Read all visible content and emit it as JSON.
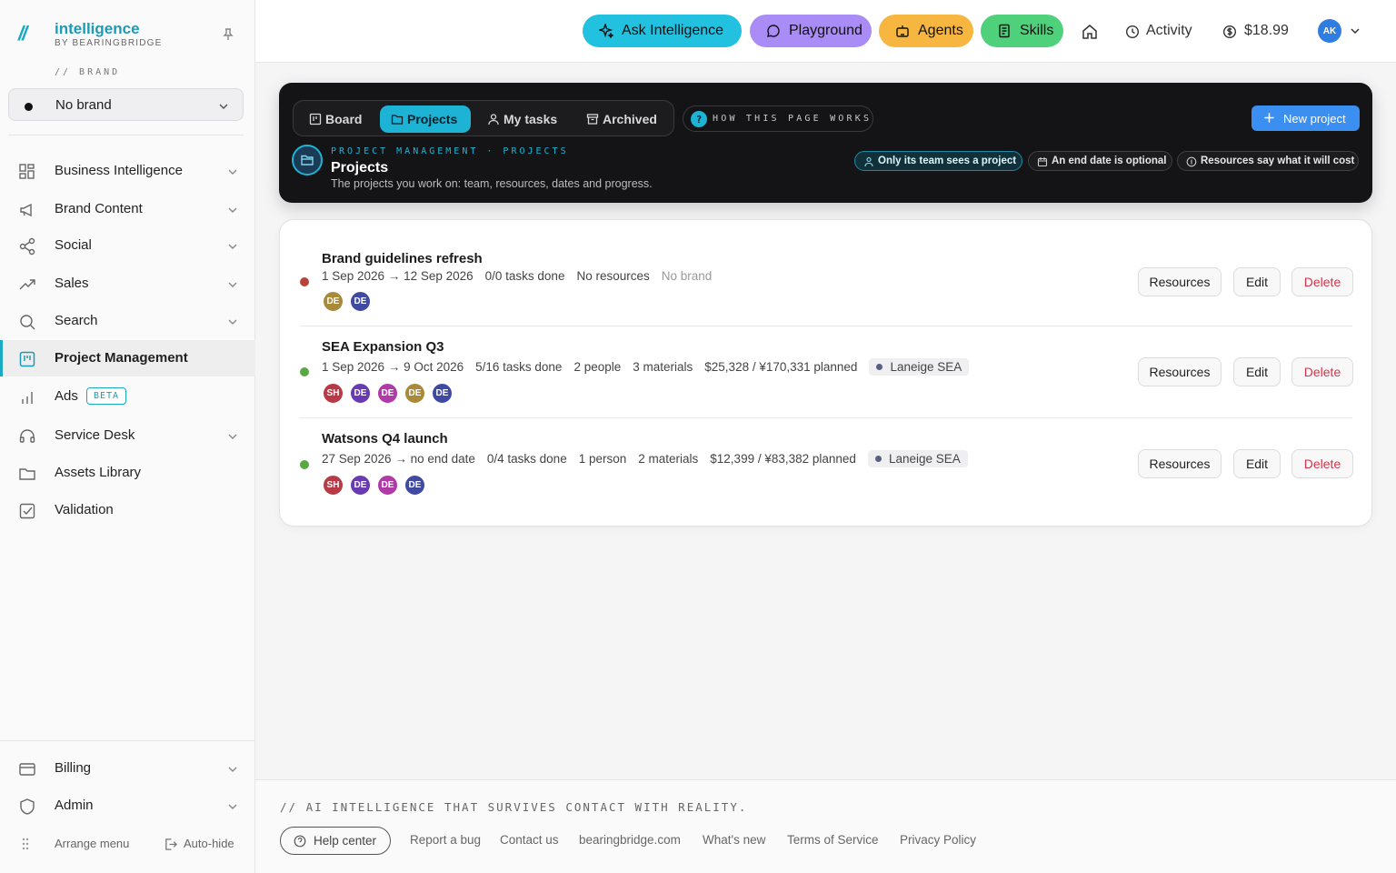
{
  "sidebar": {
    "logo_mark": "//",
    "logo_title": "intelligence",
    "logo_subtitle": "BY BEARINGBRIDGE",
    "brand_label": "// BRAND",
    "brand_select": "No brand",
    "items": [
      {
        "label": "Business Intelligence",
        "icon": "grid-icon"
      },
      {
        "label": "Brand Content",
        "icon": "megaphone-icon"
      },
      {
        "label": "Social",
        "icon": "share-icon"
      },
      {
        "label": "Sales",
        "icon": "trend-up-icon"
      },
      {
        "label": "Search",
        "icon": "search-icon"
      },
      {
        "label": "Project Management",
        "icon": "kanban-icon",
        "active": true
      },
      {
        "label": "Ads",
        "icon": "bar-chart-icon",
        "badge": "BETA"
      },
      {
        "label": "Service Desk",
        "icon": "headset-icon"
      },
      {
        "label": "Assets Library",
        "icon": "folder-icon"
      },
      {
        "label": "Validation",
        "icon": "checkbox-icon"
      }
    ],
    "bottom_items": [
      {
        "label": "Billing",
        "icon": "card-icon"
      },
      {
        "label": "Admin",
        "icon": "shield-icon"
      }
    ],
    "arrange_label": "Arrange menu",
    "autohide_label": "Auto-hide"
  },
  "topbar": {
    "ask": "Ask Intelligence",
    "playground": "Playground",
    "agents": "Agents",
    "skills": "Skills",
    "activity": "Activity",
    "balance": "$18.99",
    "avatar": "AK",
    "colors": {
      "ask": "#22c1e0",
      "playground": "#a98cf5",
      "agents": "#f6b63f",
      "skills": "#4fd07a"
    }
  },
  "hero": {
    "tabs": [
      "Board",
      "Projects",
      "My tasks",
      "Archived"
    ],
    "active_tab": "Projects",
    "how": "HOW THIS PAGE WORKS",
    "new_project": "New project",
    "eyebrow": "PROJECT MANAGEMENT · PROJECTS",
    "title": "Projects",
    "subtitle": "The projects you work on: team, resources, dates and progress.",
    "chips": [
      "Only its team sees a project",
      "An end date is optional",
      "Resources say what it will cost"
    ]
  },
  "projects": [
    {
      "name": "Brand guidelines refresh",
      "status_color": "#b8433a",
      "dates": "1 Sep 2026 → 12 Sep 2026",
      "tasks": "0/0 tasks done",
      "resources": "No resources",
      "brand": "No brand",
      "avatars": [
        {
          "initials": "DE",
          "color": "#a88a3a"
        },
        {
          "initials": "DE",
          "color": "#3f4aa0"
        }
      ]
    },
    {
      "name": "SEA Expansion Q3",
      "status_color": "#5aa843",
      "dates": "1 Sep 2026 → 9 Oct 2026",
      "tasks": "5/16 tasks done",
      "people": "2 people",
      "materials": "3 materials",
      "budget": "$25,328 / ¥170,331 planned",
      "brand": "Laneige SEA",
      "avatars": [
        {
          "initials": "SH",
          "color": "#b83a46"
        },
        {
          "initials": "DE",
          "color": "#6a3ab0"
        },
        {
          "initials": "DE",
          "color": "#b03aa8"
        },
        {
          "initials": "DE",
          "color": "#a88a3a"
        },
        {
          "initials": "DE",
          "color": "#3f4aa0"
        }
      ]
    },
    {
      "name": "Watsons Q4 launch",
      "status_color": "#5aa843",
      "dates": "27 Sep 2026 → no end date",
      "tasks": "0/4 tasks done",
      "people": "1 person",
      "materials": "2 materials",
      "budget": "$12,399 / ¥83,382 planned",
      "brand": "Laneige SEA",
      "avatars": [
        {
          "initials": "SH",
          "color": "#b83a46"
        },
        {
          "initials": "DE",
          "color": "#6a3ab0"
        },
        {
          "initials": "DE",
          "color": "#b03aa8"
        },
        {
          "initials": "DE",
          "color": "#3f4aa0"
        }
      ]
    }
  ],
  "row_actions": {
    "resources": "Resources",
    "edit": "Edit",
    "delete": "Delete"
  },
  "footer": {
    "tagline": "// AI INTELLIGENCE THAT SURVIVES CONTACT WITH REALITY.",
    "help": "Help center",
    "links": [
      "Report a bug",
      "Contact us",
      "bearingbridge.com",
      "What's new",
      "Terms of Service",
      "Privacy Policy"
    ]
  }
}
